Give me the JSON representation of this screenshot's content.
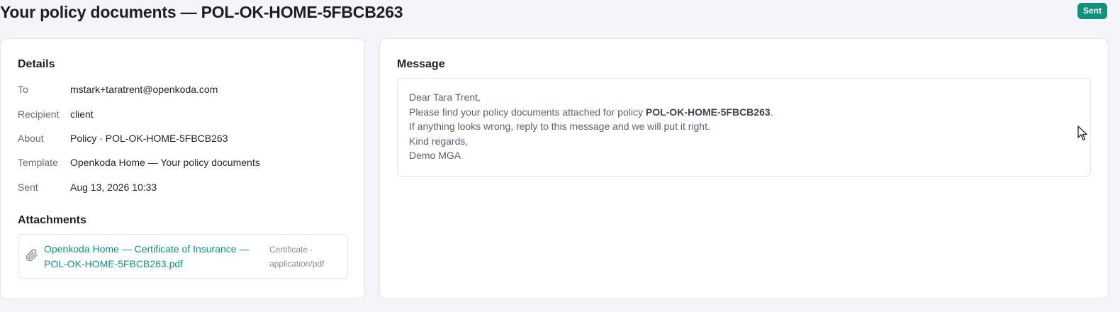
{
  "header": {
    "title": "Your policy documents — POL-OK-HOME-5FBCB263",
    "status": "Sent",
    "status_color": "#13917a"
  },
  "details": {
    "heading": "Details",
    "rows": [
      {
        "label": "To",
        "value": "mstark+taratrent@openkoda.com"
      },
      {
        "label": "Recipient",
        "value": "client"
      },
      {
        "label": "About",
        "value": "Policy · POL-OK-HOME-5FBCB263"
      },
      {
        "label": "Template",
        "value": "Openkoda Home — Your policy documents"
      },
      {
        "label": "Sent",
        "value": "Aug 13, 2026 10:33"
      }
    ]
  },
  "attachments": {
    "heading": "Attachments",
    "items": [
      {
        "icon": "paperclip-icon",
        "name": "Openkoda Home — Certificate of Insurance — POL-OK-HOME-5FBCB263.pdf",
        "meta": "Certificate · application/pdf"
      }
    ]
  },
  "message": {
    "heading": "Message",
    "greeting": "Dear Tara Trent,",
    "line2_prefix": "Please find your policy documents attached for policy ",
    "line2_policy": "POL-OK-HOME-5FBCB263",
    "line2_suffix": ".",
    "line3": "If anything looks wrong, reply to this message and we will put it right.",
    "line4": "Kind regards,",
    "line5": "Demo MGA"
  },
  "theme": {
    "accent": "#13917a",
    "background": "#f4f5f9"
  }
}
